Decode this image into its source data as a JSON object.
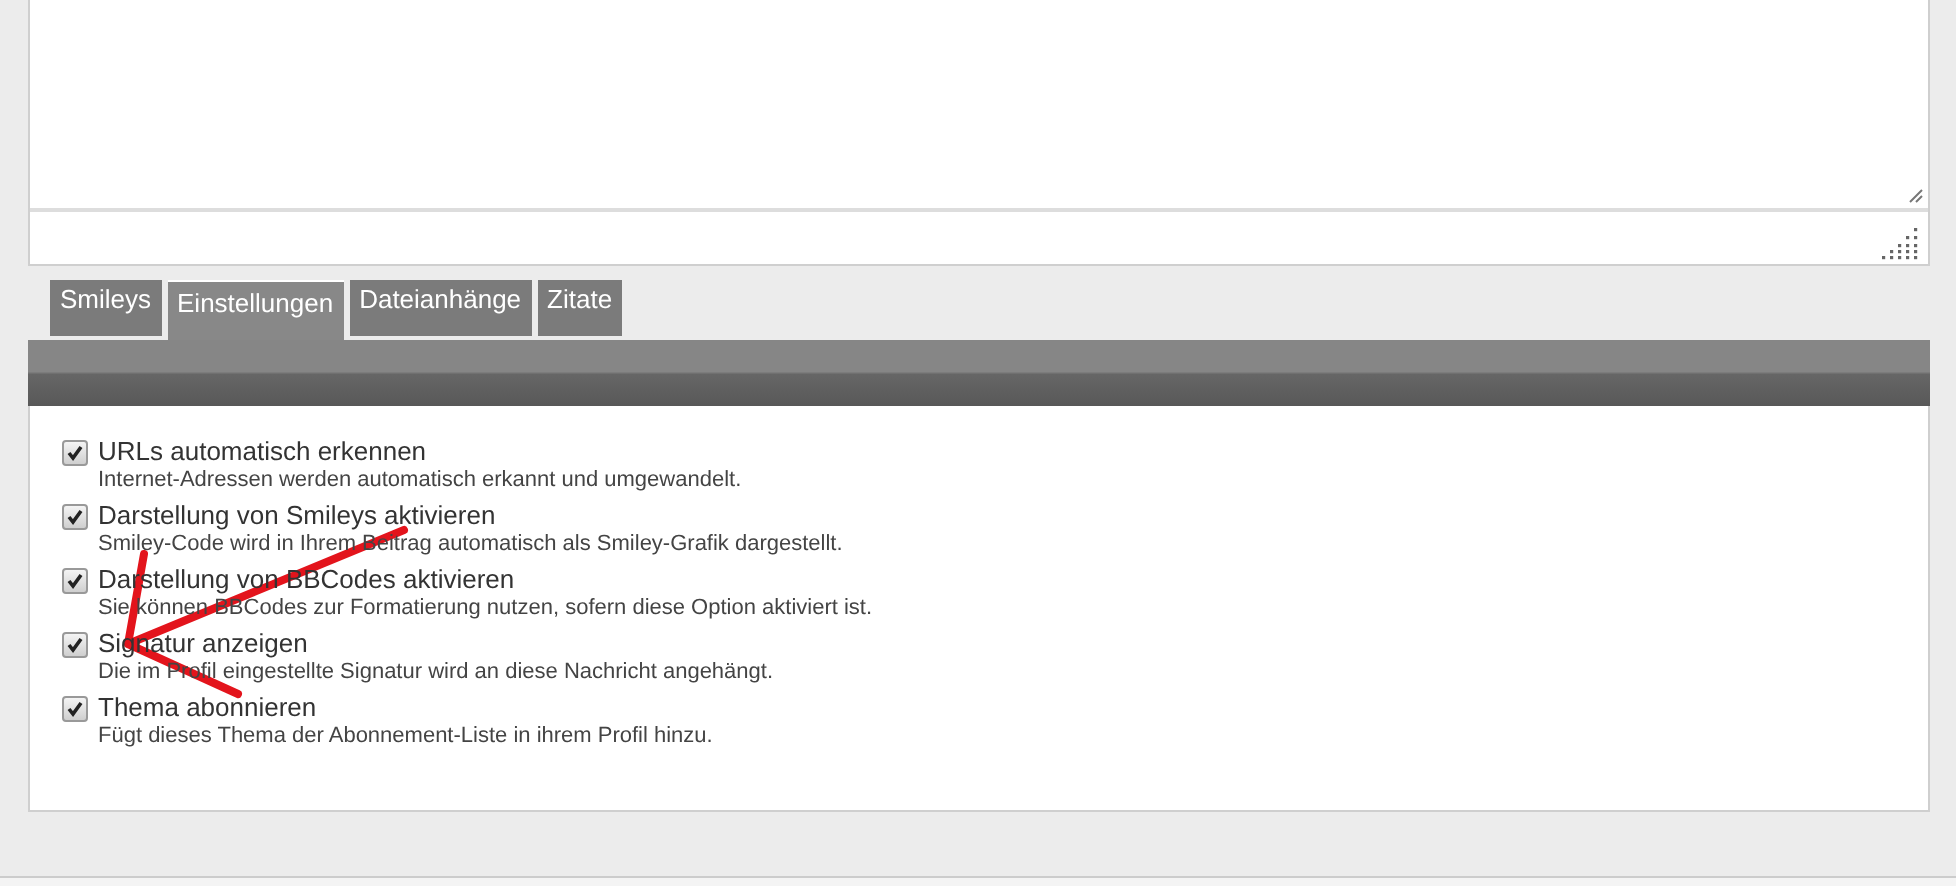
{
  "editor": {
    "kind": "textarea"
  },
  "tabs": [
    {
      "label": "Smileys",
      "selected": false
    },
    {
      "label": "Einstellungen",
      "selected": true
    },
    {
      "label": "Dateianhänge",
      "selected": false
    },
    {
      "label": "Zitate",
      "selected": false
    }
  ],
  "options": [
    {
      "label": "URLs automatisch erkennen",
      "description": "Internet-Adressen werden automatisch erkannt und umgewandelt.",
      "checked": true
    },
    {
      "label": "Darstellung von Smileys aktivieren",
      "description": "Smiley-Code wird in Ihrem Beitrag automatisch als Smiley-Grafik dargestellt.",
      "checked": true
    },
    {
      "label": "Darstellung von BBCodes aktivieren",
      "description": "Sie können BBCodes zur Formatierung nutzen, sofern diese Option aktiviert ist.",
      "checked": true
    },
    {
      "label": "Signatur anzeigen",
      "description": "Die im Profil eingestellte Signatur wird an diese Nachricht angehängt.",
      "checked": true
    },
    {
      "label": "Thema abonnieren",
      "description": "Fügt dieses Thema der Abonnement-Liste in ihrem Profil hinzu.",
      "checked": true
    }
  ]
}
